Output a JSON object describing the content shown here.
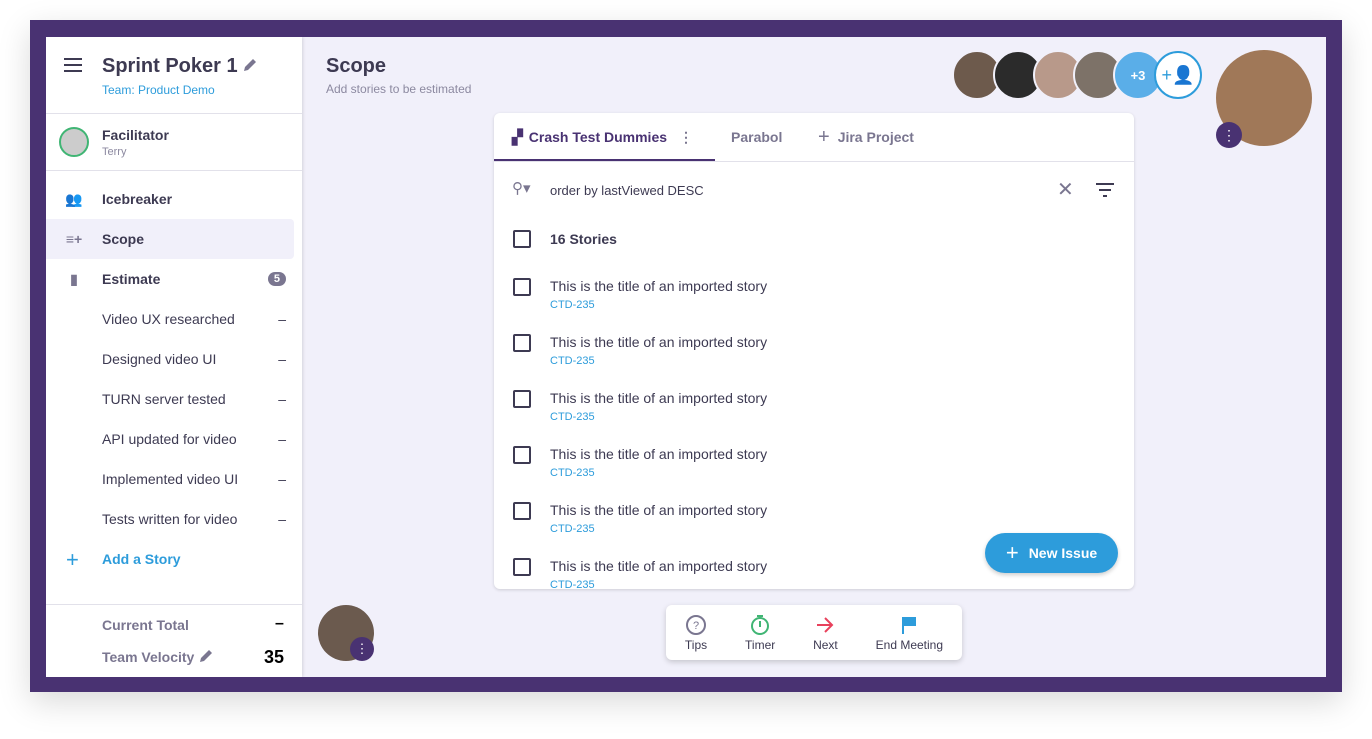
{
  "sidebar": {
    "title": "Sprint Poker 1",
    "team": "Team: Product Demo",
    "facilitator_label": "Facilitator",
    "facilitator_name": "Terry",
    "nav": [
      {
        "label": "Icebreaker",
        "icon": "group-icon"
      },
      {
        "label": "Scope",
        "icon": "playlist-add-icon"
      },
      {
        "label": "Estimate",
        "icon": "cards-icon",
        "badge": "5"
      }
    ],
    "stories": [
      {
        "label": "Video UX researched",
        "value": "–"
      },
      {
        "label": "Designed video UI",
        "value": "–"
      },
      {
        "label": "TURN server tested",
        "value": "–"
      },
      {
        "label": "API updated for video",
        "value": "–"
      },
      {
        "label": "Implemented video UI",
        "value": "–"
      },
      {
        "label": "Tests written for video",
        "value": "–"
      }
    ],
    "add_story": "Add a Story",
    "current_total_label": "Current Total",
    "current_total": "–",
    "velocity_label": "Team Velocity",
    "velocity": "35"
  },
  "header": {
    "title": "Scope",
    "subtitle": "Add stories to be estimated",
    "extra_avatars": "+3"
  },
  "tabs": [
    {
      "label": "Crash Test Dummies"
    },
    {
      "label": "Parabol"
    },
    {
      "label": "Jira Project"
    }
  ],
  "search": {
    "query": "order by lastViewed DESC"
  },
  "list": {
    "count_label": "16 Stories",
    "items": [
      {
        "title": "This is the title of an imported story",
        "key": "CTD-235"
      },
      {
        "title": "This is the title of an imported story",
        "key": "CTD-235"
      },
      {
        "title": "This is the title of an imported story",
        "key": "CTD-235"
      },
      {
        "title": "This is the title of an imported story",
        "key": "CTD-235"
      },
      {
        "title": "This is the title of an imported story",
        "key": "CTD-235"
      },
      {
        "title": "This is the title of an imported story",
        "key": "CTD-235"
      }
    ]
  },
  "new_issue": "New Issue",
  "dock": {
    "tips": "Tips",
    "timer": "Timer",
    "next": "Next",
    "end": "End Meeting"
  },
  "colors": {
    "frame": "#493272",
    "accent": "#2d9cdb",
    "primary": "#493272",
    "green": "#40b574",
    "red": "#e8415c"
  }
}
